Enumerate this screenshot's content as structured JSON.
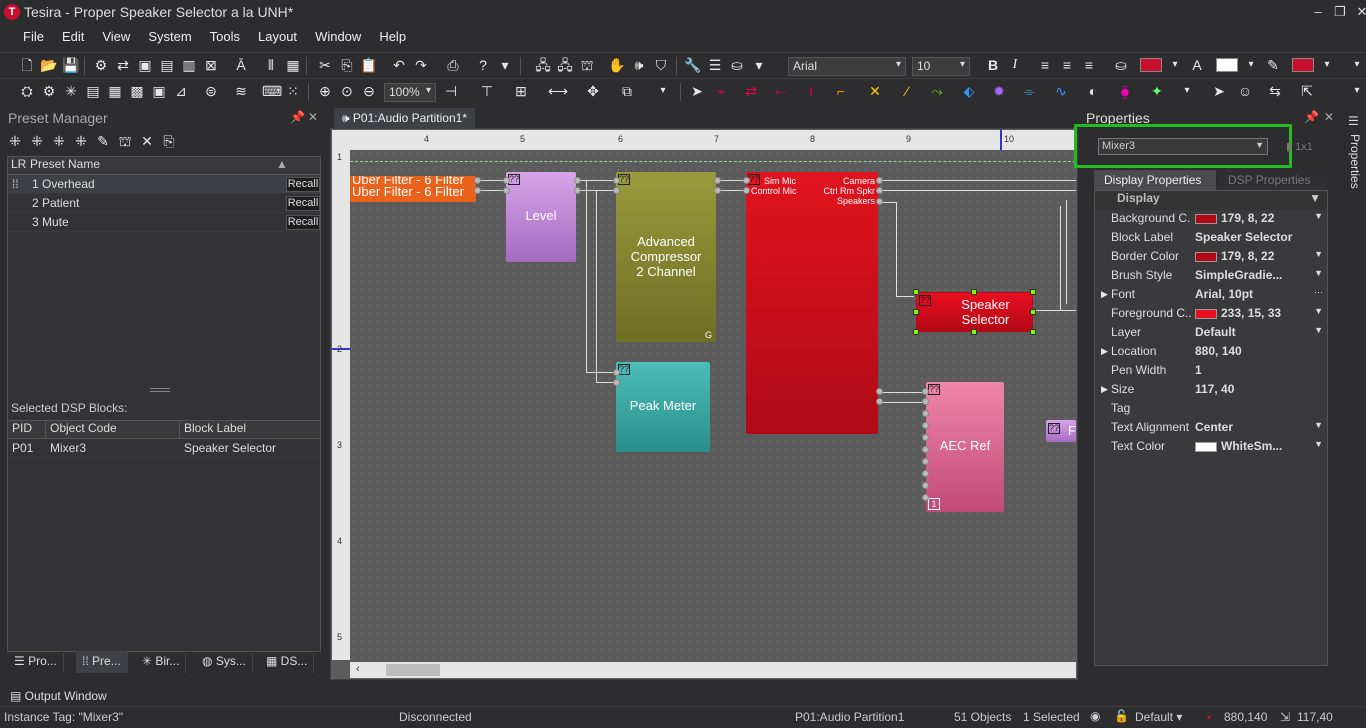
{
  "window": {
    "title": "Tesira - Proper Speaker Selector a la UNH*",
    "app_icon": "T"
  },
  "menu": [
    "File",
    "Edit",
    "View",
    "System",
    "Tools",
    "Layout",
    "Window",
    "Help"
  ],
  "toolbar": {
    "font_name": "Arial",
    "font_size": "10",
    "zoom": "100%",
    "fill_color": "#c8102e",
    "text_color": "#ffffff",
    "line_color": "#c8102e"
  },
  "preset_manager": {
    "title": "Preset Manager",
    "columns": {
      "lr": "LR",
      "name": "Preset Name"
    },
    "presets": [
      {
        "name": "1 Overhead",
        "action": "Recall"
      },
      {
        "name": "2 Patient",
        "action": "Recall"
      },
      {
        "name": "3 Mute",
        "action": "Recall"
      }
    ],
    "selected_title": "Selected DSP Blocks:",
    "selected_columns": {
      "pid": "PID",
      "code": "Object Code",
      "label": "Block Label"
    },
    "selected_rows": [
      {
        "pid": "P01",
        "code": "Mixer3",
        "label": "Speaker Selector"
      }
    ]
  },
  "left_tabs": [
    "Pro...",
    "Pre...",
    "Bir...",
    "Sys...",
    "DS..."
  ],
  "document_tab": "P01:Audio Partition1*",
  "ruler": {
    "top": [
      "4",
      "5",
      "6",
      "7",
      "8",
      "9",
      "10"
    ],
    "left": [
      "1",
      "2",
      "3",
      "4",
      "5"
    ]
  },
  "blocks": {
    "uber1": "Uber Filter - 6 Filter",
    "uber2": "Uber Filter - 6 Filter",
    "level": "Level",
    "compressor": "Advanced Compressor 2 Channel",
    "compressor_g": "G",
    "peak": "Peak Meter",
    "mixer_in1": "Sim Mic",
    "mixer_in2": "Control Mic",
    "mixer_out1": "Camera",
    "mixer_out2": "Ctrl Rm Spkr",
    "mixer_out3": "Speakers",
    "speaker": "Speaker Selector",
    "aec": "AEC Ref",
    "aec_num": "1",
    "tag": "??",
    "partial": "F"
  },
  "properties": {
    "title": "Properties",
    "object": "Mixer3",
    "grid_label": "1x1",
    "tab_display": "Display Properties",
    "tab_dsp": "DSP Properties",
    "section": "Display",
    "rows": [
      {
        "name": "Background C...",
        "value": "179, 8, 22",
        "swatch": "#b30816",
        "dropdown": true
      },
      {
        "name": "Block Label",
        "value": "Speaker Selector"
      },
      {
        "name": "Border Color",
        "value": "179, 8, 22",
        "swatch": "#b30816",
        "dropdown": true
      },
      {
        "name": "Brush Style",
        "value": "SimpleGradie...",
        "dropdown": true
      },
      {
        "name": "Font",
        "value": "Arial, 10pt",
        "expand": true,
        "ellipsis": true
      },
      {
        "name": "Foreground C...",
        "value": "233, 15, 33",
        "swatch": "#e90f21",
        "dropdown": true
      },
      {
        "name": "Layer",
        "value": "Default",
        "dropdown": true
      },
      {
        "name": "Location",
        "value": "880, 140",
        "expand": true
      },
      {
        "name": "Pen Width",
        "value": "1"
      },
      {
        "name": "Size",
        "value": "117, 40",
        "expand": true
      },
      {
        "name": "Tag",
        "value": ""
      },
      {
        "name": "Text Alignment",
        "value": "Center",
        "dropdown": true
      },
      {
        "name": "Text Color",
        "value": "WhiteSm...",
        "swatch": "#ffffff",
        "dropdown": true
      }
    ],
    "side_tab": "Properties"
  },
  "output_window": "Output Window",
  "status": {
    "instance": "Instance Tag: \"Mixer3\"",
    "connection": "Disconnected",
    "partition": "P01:Audio Partition1",
    "objects": "51 Objects",
    "selected": "1 Selected",
    "layer": "Default",
    "location": "880,140",
    "size": "117,40"
  }
}
